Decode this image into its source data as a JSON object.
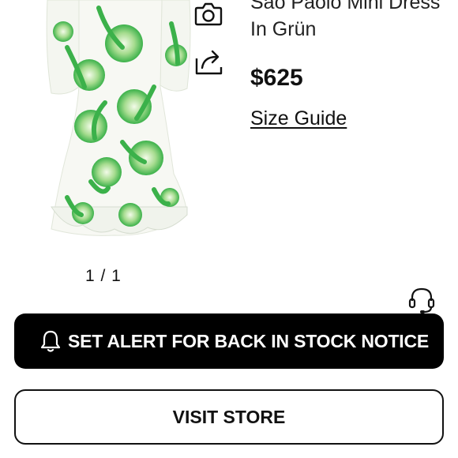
{
  "product": {
    "title": "Sao Paolo Mini Dress In Grün",
    "price": "$625",
    "size_guide_label": "Size Guide",
    "image_alt": "Green and white printed mini dress"
  },
  "gallery": {
    "pager": "1 / 1"
  },
  "actions": {
    "alert_label": "SET ALERT FOR BACK IN STOCK NOTICE",
    "visit_store_label": "VISIT STORE"
  },
  "icons": {
    "camera": "camera-icon",
    "share": "share-icon",
    "bell": "bell-icon",
    "support": "headset-icon"
  },
  "colors": {
    "print_green": "#3bb14a",
    "print_light_green": "#a6dc8f",
    "button_black": "#000000"
  }
}
